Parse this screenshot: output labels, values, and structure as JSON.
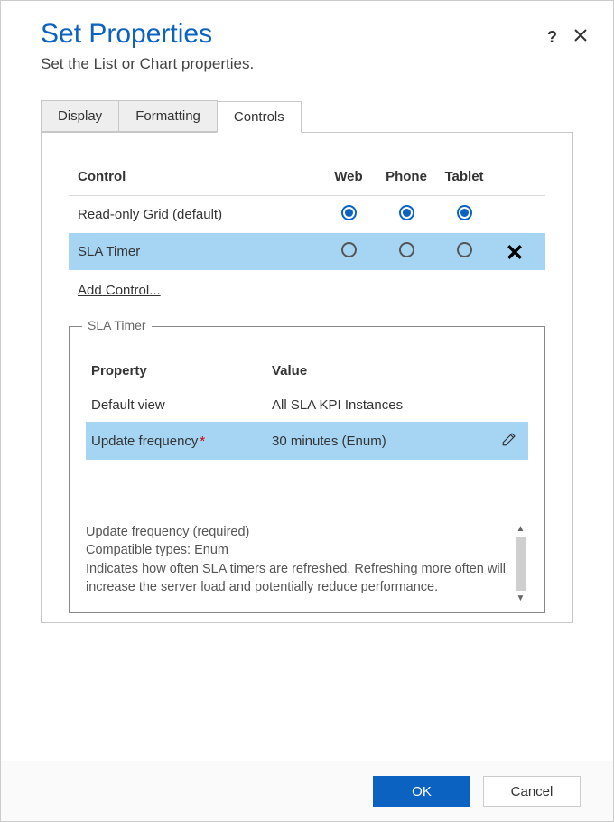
{
  "header": {
    "title": "Set Properties",
    "subtitle": "Set the List or Chart properties."
  },
  "tabs": {
    "display": "Display",
    "formatting": "Formatting",
    "controls": "Controls"
  },
  "controls_grid": {
    "col_control": "Control",
    "col_web": "Web",
    "col_phone": "Phone",
    "col_tablet": "Tablet",
    "row1_label": "Read-only Grid (default)",
    "row2_label": "SLA Timer",
    "add_control": "Add Control..."
  },
  "fieldset": {
    "legend": "SLA Timer",
    "col_property": "Property",
    "col_value": "Value",
    "row1_prop": "Default view",
    "row1_val": "All SLA KPI Instances",
    "row2_prop": "Update frequency",
    "row2_val": "30 minutes (Enum)"
  },
  "description": {
    "line1": "Update frequency (required)",
    "line2": "Compatible types: Enum",
    "line3": "Indicates how often SLA timers are refreshed. Refreshing more often will increase the server load and potentially reduce performance."
  },
  "footer": {
    "ok": "OK",
    "cancel": "Cancel"
  }
}
